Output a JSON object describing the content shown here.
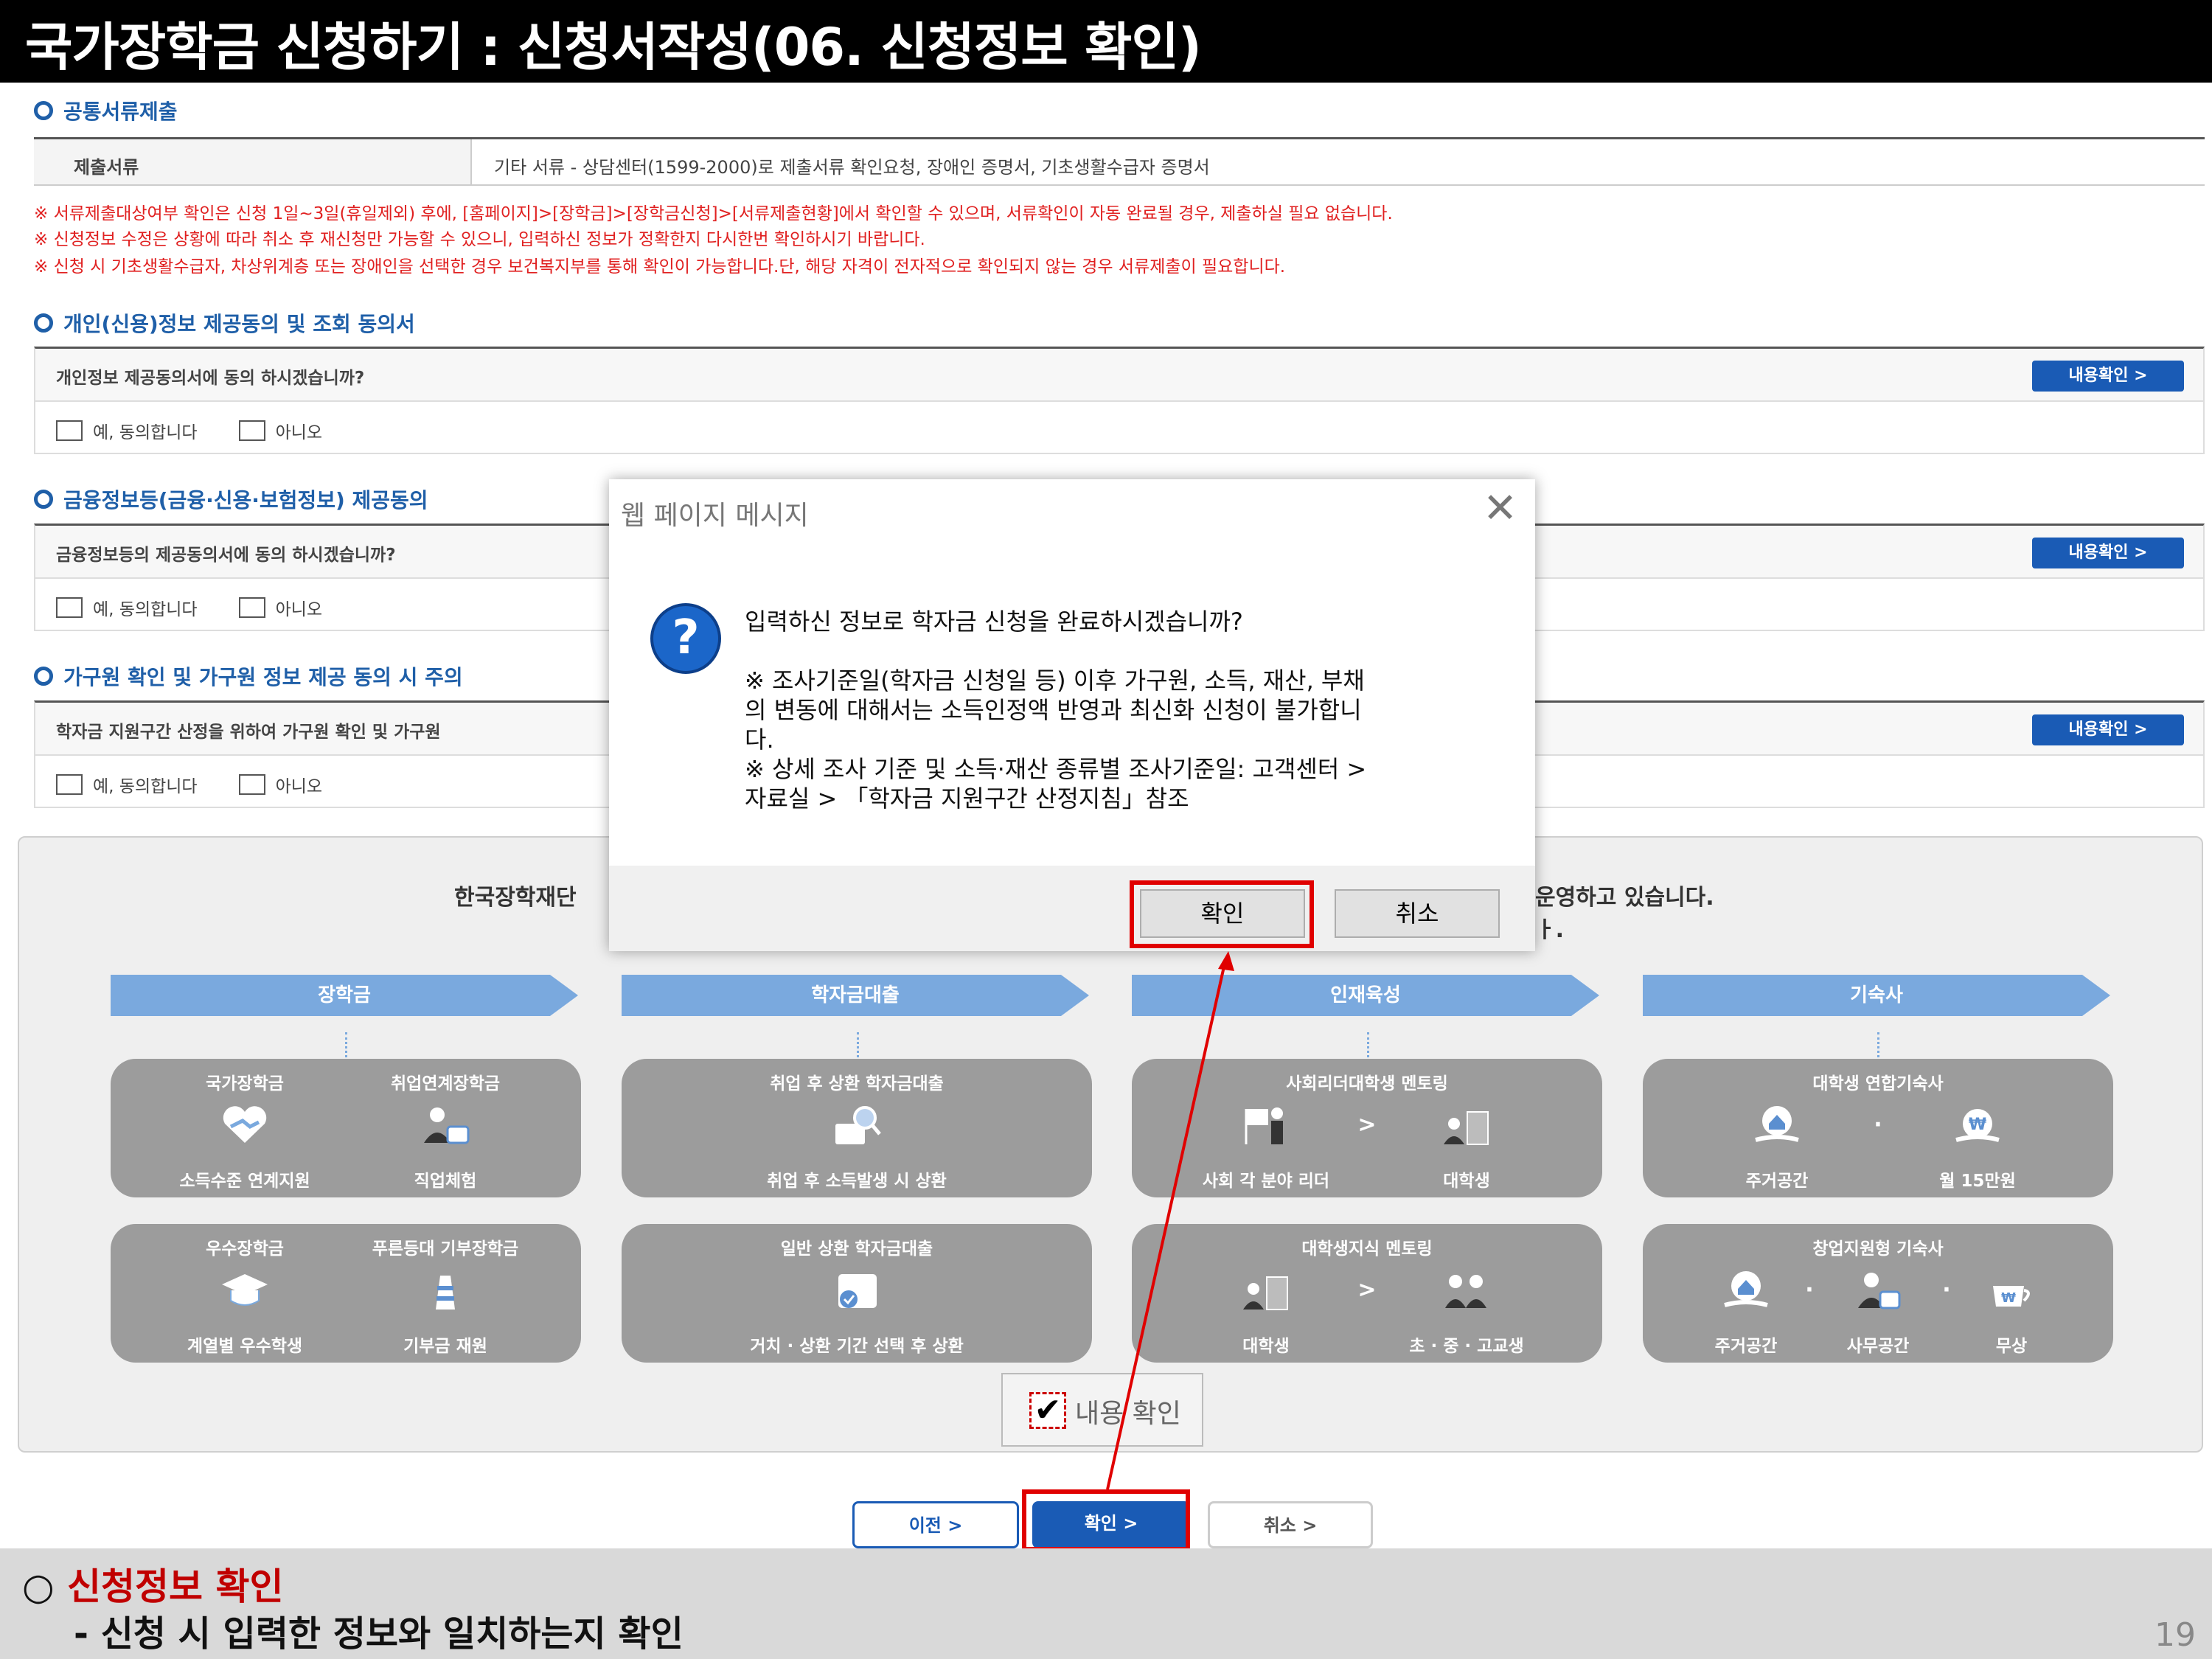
{
  "title": "국가장학금 신청하기 : 신청서작성(06. 신청정보 확인)",
  "common_docs": {
    "heading": "공통서류제출",
    "label": "제출서류",
    "value": "기타 서류 - 상담센터(1599-2000)로 제출서류 확인요청, 장애인 증명서, 기초생활수급자 증명서"
  },
  "notices": [
    "※ 서류제출대상여부 확인은 신청 1일~3일(휴일제외) 후에, [홈페이지]>[장학금]>[장학금신청]>[서류제출현황]에서 확인할 수 있으며, 서류확인이 자동 완료될 경우, 제출하실 필요 없습니다.",
    "※ 신청정보 수정은 상황에 따라 취소 후 재신청만 가능할 수 있으니, 입력하신 정보가 정확한지 다시한번 확인하시기 바랍니다.",
    "※ 신청 시 기초생활수급자, 차상위계층 또는 장애인을 선택한 경우 보건복지부를 통해 확인이 가능합니다.단, 해당 자격이 전자적으로 확인되지 않는 경우 서류제출이 필요합니다."
  ],
  "consents": [
    {
      "heading": "개인(신용)정보 제공동의 및 조회 동의서",
      "question": "개인정보 제공동의서에 동의 하시겠습니까?",
      "view": "내용확인 >",
      "yes": "예, 동의합니다",
      "no": "아니오"
    },
    {
      "heading": "금융정보등(금융·신용·보험정보) 제공동의",
      "question": "금융정보등의 제공동의서에 동의 하시겠습니까?",
      "view": "내용확인 >",
      "yes": "예, 동의합니다",
      "no": "아니오"
    },
    {
      "heading": "가구원 확인 및 가구원 정보 제공 동의 시 주의",
      "question": "학자금 지원구간 산정을 위하여 가구원 확인 및 가구원",
      "view": "내용확인 >",
      "yes": "예, 동의합니다",
      "no": "아니오"
    }
  ],
  "panel": {
    "text_left": "한국장학재단",
    "text_right1": "운영하고 있습니다.",
    "text_right2": "ㅏ.",
    "columns": [
      {
        "label": "장학금",
        "cards": [
          {
            "items": [
              {
                "top": "국가장학금",
                "bottom": "소득수준 연계지원",
                "icon": "handshake-heart-icon"
              },
              {
                "top": "취업연계장학금",
                "bottom": "직업체험",
                "icon": "worker-briefcase-icon"
              }
            ]
          },
          {
            "items": [
              {
                "top": "우수장학금",
                "bottom": "계열별 우수학생",
                "icon": "graduation-cap-icon"
              },
              {
                "top": "푸른등대 기부장학금",
                "bottom": "기부금 재원",
                "icon": "lighthouse-icon"
              }
            ]
          }
        ]
      },
      {
        "label": "학자금대출",
        "cards": [
          {
            "items": [
              {
                "top": "취업 후 상환 학자금대출",
                "bottom": "취업 후 소득발생 시 상환",
                "icon": "briefcase-search-icon"
              }
            ]
          },
          {
            "items": [
              {
                "top": "일반 상환 학자금대출",
                "bottom": "거치 · 상환 기간 선택 후 상환",
                "icon": "calendar-check-icon"
              }
            ]
          }
        ]
      },
      {
        "label": "인재육성",
        "cards": [
          {
            "items": [
              {
                "top": "사회리더대학생 멘토링",
                "bottom": "사회 각 분야 리더",
                "icon": "leader-flag-icon"
              },
              {
                "top": "",
                "bottom": "대학생",
                "icon": "students-building-icon"
              }
            ],
            "sep": ">"
          },
          {
            "items": [
              {
                "top": "대학생지식 멘토링",
                "bottom": "대학생",
                "icon": "students-building-icon"
              },
              {
                "top": "",
                "bottom": "초 · 중 · 고교생",
                "icon": "children-icon"
              }
            ],
            "sep": ">"
          }
        ]
      },
      {
        "label": "기숙사",
        "cards": [
          {
            "items": [
              {
                "top": "대학생 연합기숙사",
                "bottom": "주거공간",
                "icon": "house-hand-icon"
              },
              {
                "top": "",
                "bottom": "월 15만원",
                "icon": "won-coin-icon"
              }
            ],
            "sep": "·"
          },
          {
            "items": [
              {
                "top": "창업지원형 기숙사",
                "bottom": "주거공간",
                "icon": "house-hand-icon"
              },
              {
                "top": "",
                "bottom": "사무공간",
                "icon": "office-worker-icon"
              },
              {
                "top": "",
                "bottom": "무상",
                "icon": "coffee-won-icon"
              }
            ],
            "sep": "·"
          }
        ]
      }
    ]
  },
  "content_check": {
    "mark": "✔",
    "label": "내용 확인"
  },
  "bottom_buttons": {
    "prev": "이전 >",
    "confirm": "확인 >",
    "cancel": "취소 >"
  },
  "dialog": {
    "title": "웹 페이지 메시지",
    "close": "✕",
    "icon": "?",
    "lines": [
      "입력하신 정보로 학자금 신청을 완료하시겠습니까?",
      "",
      " ※  조사기준일(학자금 신청일 등) 이후 가구원, 소득, 재산, 부채",
      "의 변동에 대해서는 소득인정액 반영과 최신화 신청이 불가합니",
      "다.",
      "※ 상세 조사 기준 및 소득·재산 종류별 조사기준일: 고객센터 >",
      "자료실 > 「학자금 지원구간 산정지침」참조"
    ],
    "ok": "확인",
    "cancel": "취소"
  },
  "note": {
    "bullet": "○ ",
    "heading": "신청정보 확인",
    "detail": "- 신청 시 입력한 정보와 일치하는지 확인"
  },
  "page_number": "19",
  "colors": {
    "accent_blue": "#1a5bb5",
    "heading_blue": "#1f5fa8",
    "notice_red": "#e02020",
    "highlight_red": "#e00000",
    "band_blue": "#7aa9de",
    "card_gray": "#9c9c9c"
  }
}
